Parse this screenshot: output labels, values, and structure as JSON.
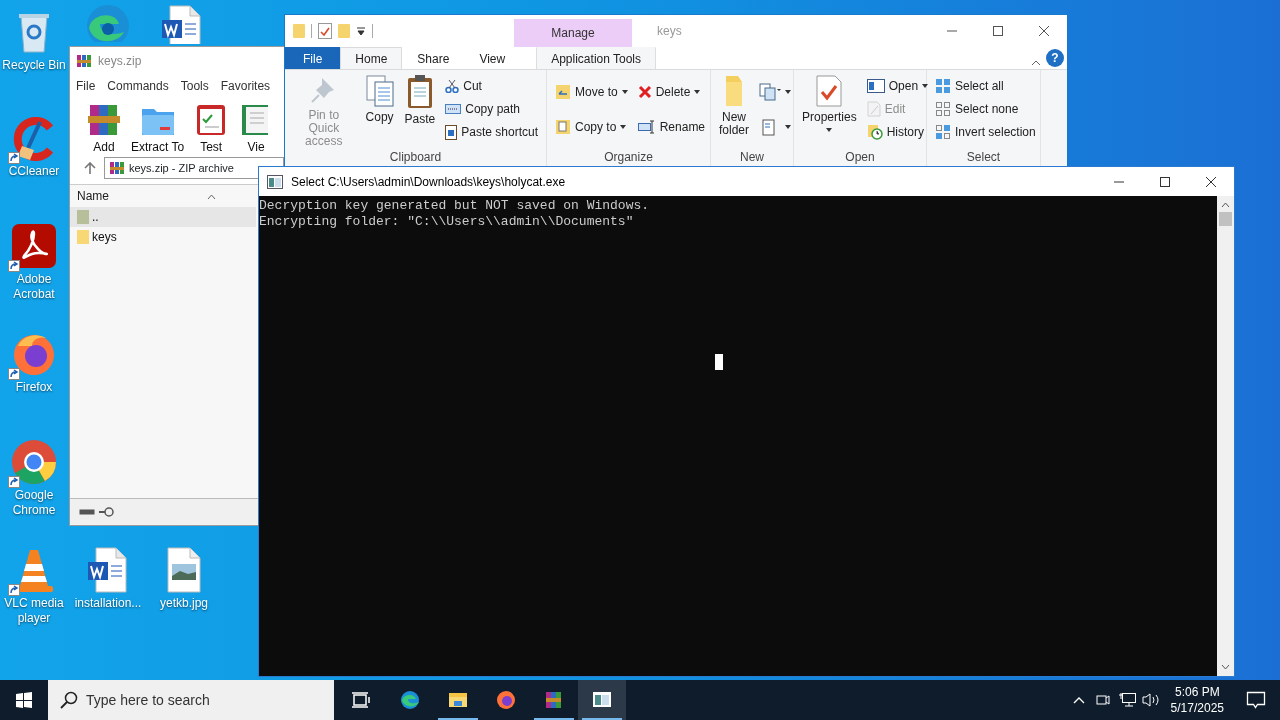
{
  "desktop_icons": [
    {
      "label": "Recycle Bin",
      "shortcut": false
    },
    {
      "label": "CCleaner",
      "shortcut": true
    },
    {
      "label": "Adobe Acrobat",
      "shortcut": true
    },
    {
      "label": "Firefox",
      "shortcut": true
    },
    {
      "label": "Google Chrome",
      "shortcut": true
    },
    {
      "label": "VLC media player",
      "shortcut": true
    },
    {
      "label": "installation...",
      "shortcut": false
    },
    {
      "label": "yetkb.jpg",
      "shortcut": false
    },
    {
      "shortcut": false
    },
    {
      "shortcut": false
    }
  ],
  "winrar": {
    "title": "keys.zip",
    "menu": [
      "File",
      "Commands",
      "Tools",
      "Favorites"
    ],
    "toolbar": [
      "Add",
      "Extract To",
      "Test",
      "Vie"
    ],
    "address": "keys.zip - ZIP archive",
    "column": "Name",
    "rows": [
      {
        "name": "..",
        "kind": "parent",
        "selected": true
      },
      {
        "name": "keys",
        "kind": "folder",
        "selected": false
      }
    ]
  },
  "explorer": {
    "context_tab": "Manage",
    "title": "keys",
    "help": "?",
    "tabs": [
      {
        "label": "File",
        "kind": "file",
        "selected": false
      },
      {
        "label": "Home",
        "kind": "tab",
        "selected": true
      },
      {
        "label": "Share",
        "kind": "tab",
        "selected": false
      },
      {
        "label": "View",
        "kind": "tab",
        "selected": false
      },
      {
        "label": "Application Tools",
        "kind": "context",
        "selected": false
      }
    ],
    "groups": [
      {
        "label": "Clipboard",
        "columns": [
          {
            "kind": "large",
            "items": [
              {
                "label": "Pin to Quick access",
                "disabled": true,
                "dropdown": false
              }
            ]
          },
          {
            "kind": "large",
            "items": [
              {
                "label": "Copy",
                "disabled": false,
                "dropdown": false
              }
            ]
          },
          {
            "kind": "large",
            "items": [
              {
                "label": "Paste",
                "disabled": false,
                "dropdown": false
              }
            ]
          },
          {
            "kind": "small",
            "items": [
              {
                "label": "Cut",
                "disabled": false,
                "dropdown": false
              },
              {
                "label": "Copy path",
                "disabled": false,
                "dropdown": false
              },
              {
                "label": "Paste shortcut",
                "disabled": false,
                "dropdown": false
              }
            ]
          }
        ]
      },
      {
        "label": "Organize",
        "columns": [
          {
            "kind": "small",
            "items": [
              {
                "label": "Move to",
                "disabled": false,
                "dropdown": true
              },
              {
                "label": "Copy to",
                "disabled": false,
                "dropdown": true
              }
            ]
          },
          {
            "kind": "small",
            "items": [
              {
                "label": "Delete",
                "disabled": false,
                "dropdown": true
              },
              {
                "label": "Rename",
                "disabled": false,
                "dropdown": false
              }
            ]
          }
        ]
      },
      {
        "label": "New",
        "columns": [
          {
            "kind": "large",
            "items": [
              {
                "label": "New folder",
                "disabled": false,
                "dropdown": false
              }
            ]
          },
          {
            "kind": "small",
            "items": [
              {
                "disabled": false,
                "dropdown": true
              },
              {
                "disabled": false,
                "dropdown": true
              }
            ]
          }
        ]
      },
      {
        "label": "Open",
        "columns": [
          {
            "kind": "large",
            "items": [
              {
                "label": "Properties",
                "disabled": false,
                "dropdown": true
              }
            ]
          },
          {
            "kind": "small",
            "items": [
              {
                "label": "Open",
                "disabled": false,
                "dropdown": true
              },
              {
                "label": "Edit",
                "disabled": true,
                "dropdown": false
              },
              {
                "label": "History",
                "disabled": false,
                "dropdown": false
              }
            ]
          }
        ]
      },
      {
        "label": "Select",
        "columns": [
          {
            "kind": "small",
            "items": [
              {
                "label": "Select all",
                "disabled": false,
                "dropdown": false
              },
              {
                "label": "Select none",
                "disabled": false,
                "dropdown": false
              },
              {
                "label": "Invert selection",
                "disabled": false,
                "dropdown": false
              }
            ]
          }
        ]
      }
    ]
  },
  "console": {
    "title": "Select C:\\Users\\admin\\Downloads\\keys\\holycat.exe",
    "lines": [
      "Decryption key generated but NOT saved on Windows.",
      "Encrypting folder: \"C:\\\\Users\\\\admin\\\\Documents\""
    ]
  },
  "taskbar": {
    "search_placeholder": "Type here to search",
    "apps": [
      {
        "running": false,
        "active": false
      },
      {
        "running": false,
        "active": false
      },
      {
        "running": true,
        "active": false
      },
      {
        "running": false,
        "active": false
      },
      {
        "running": true,
        "active": false
      },
      {
        "running": true,
        "active": true
      }
    ],
    "time": "5:06 PM",
    "date": "5/17/2025"
  }
}
